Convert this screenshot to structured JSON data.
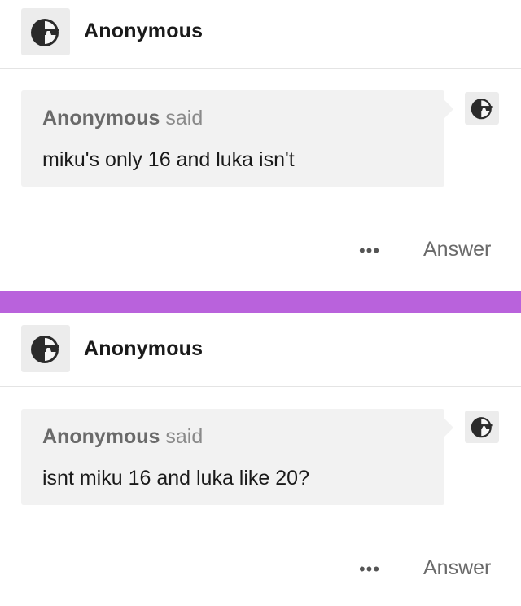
{
  "posts": [
    {
      "blog_name": "Anonymous",
      "avatar_icon": "anonymous-sunglasses-icon",
      "asker": "Anonymous",
      "said": "said",
      "question": "miku's only 16 and luka isn't",
      "more": "•••",
      "answer_label": "Answer"
    },
    {
      "blog_name": "Anonymous",
      "avatar_icon": "anonymous-sunglasses-icon",
      "asker": "Anonymous",
      "said": "said",
      "question": "isnt miku 16 and luka like 20?",
      "more": "•••",
      "answer_label": "Answer"
    }
  ],
  "colors": {
    "divider": "#b962dc",
    "bubble": "#f2f2f2",
    "avatar_bg": "#ececec",
    "text_muted": "#6a6a6a"
  }
}
